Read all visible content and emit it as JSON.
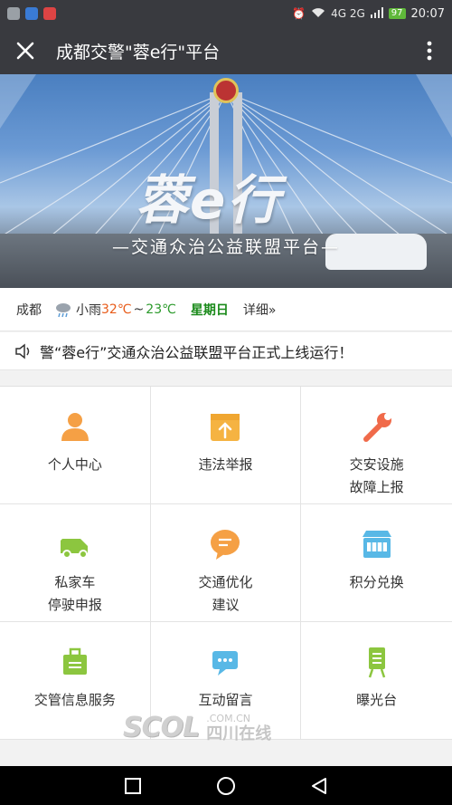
{
  "statusbar": {
    "network": "4G 2G",
    "battery": "97",
    "time": "20:07"
  },
  "titlebar": {
    "close_icon": "close-icon",
    "title": "成都交警\"蓉e行\"平台",
    "more_icon": "more-vertical-icon"
  },
  "banner": {
    "brand": "蓉e行",
    "slogan": "—交通众治公益联盟平台—"
  },
  "weather": {
    "city": "成都",
    "condition": "小雨",
    "high": "32℃",
    "sep": "~",
    "low": "23℃",
    "weekday": "星期日",
    "detail": "详细»"
  },
  "notice": {
    "icon": "speaker-icon",
    "text": "警“蓉e行”交通众治公益联盟平台正式上线运行！"
  },
  "grid": [
    {
      "label": "个人中心",
      "icon": "person-icon",
      "color": "#f5a045"
    },
    {
      "label": "违法举报",
      "icon": "upload-report-icon",
      "color": "#f5b342"
    },
    {
      "label": "交安设施\n故障上报",
      "icon": "wrench-icon",
      "color": "#f06a4a"
    },
    {
      "label": "私家车\n停驶申报",
      "icon": "car-icon",
      "color": "#8cc63f"
    },
    {
      "label": "交通优化\n建议",
      "icon": "chat-bubble-icon",
      "color": "#f5a045"
    },
    {
      "label": "积分兑换",
      "icon": "store-icon",
      "color": "#58b8e6"
    },
    {
      "label": "交管信息服务",
      "icon": "briefcase-icon",
      "color": "#8cc63f"
    },
    {
      "label": "互动留言",
      "icon": "message-icon",
      "color": "#58b8e6"
    },
    {
      "label": "曝光台",
      "icon": "billboard-icon",
      "color": "#8cc63f"
    }
  ],
  "watermark": {
    "logo": "SCOL",
    "domain": ".COM.CN",
    "name": "四川在线"
  }
}
